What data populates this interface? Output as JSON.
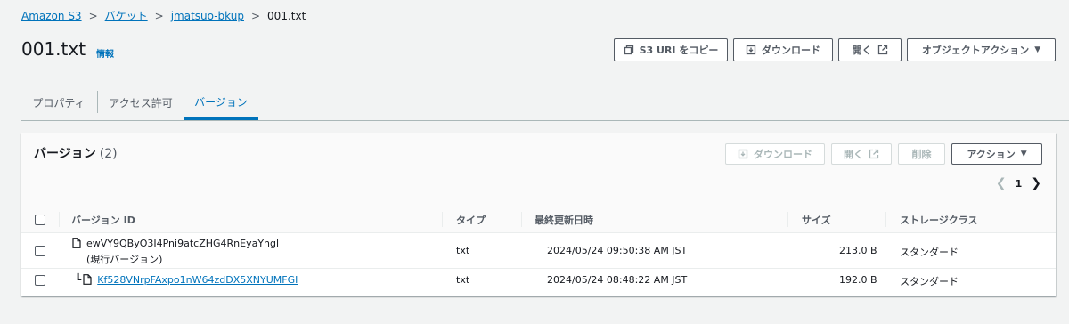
{
  "breadcrumb": {
    "items": [
      "Amazon S3",
      "バケット",
      "jmatsuo-bkup"
    ],
    "current": "001.txt"
  },
  "header": {
    "title": "001.txt",
    "info": "情報",
    "buttons": {
      "copy_uri": "S3 URI をコピー",
      "download": "ダウンロード",
      "open": "開く",
      "object_actions": "オブジェクトアクション"
    }
  },
  "tabs": [
    "プロパティ",
    "アクセス許可",
    "バージョン"
  ],
  "active_tab": "バージョン",
  "versions": {
    "title": "バージョン",
    "count": "(2)",
    "buttons": {
      "download": "ダウンロード",
      "open": "開く",
      "delete": "削除",
      "actions": "アクション"
    },
    "page": "1",
    "columns": [
      "バージョン ID",
      "タイプ",
      "最終更新日時",
      "サイズ",
      "ストレージクラス"
    ],
    "rows": [
      {
        "version_id": "ewVY9QByO3I4Pni9atcZHG4RnEyaYngl",
        "note": "(現行バージョン)",
        "type": "txt",
        "modified": "2024/05/24 09:50:38 AM JST",
        "size": "213.0 B",
        "storage": "スタンダード"
      },
      {
        "version_id": "Kf528VNrpFAxpo1nW64zdDX5XNYUMFGI",
        "type": "txt",
        "modified": "2024/05/24 08:48:22 AM JST",
        "size": "192.0 B",
        "storage": "スタンダード"
      }
    ]
  },
  "colors": {
    "link": "#0073bb",
    "text": "#16191f",
    "muted": "#545b64",
    "background": "#f2f3f3"
  }
}
